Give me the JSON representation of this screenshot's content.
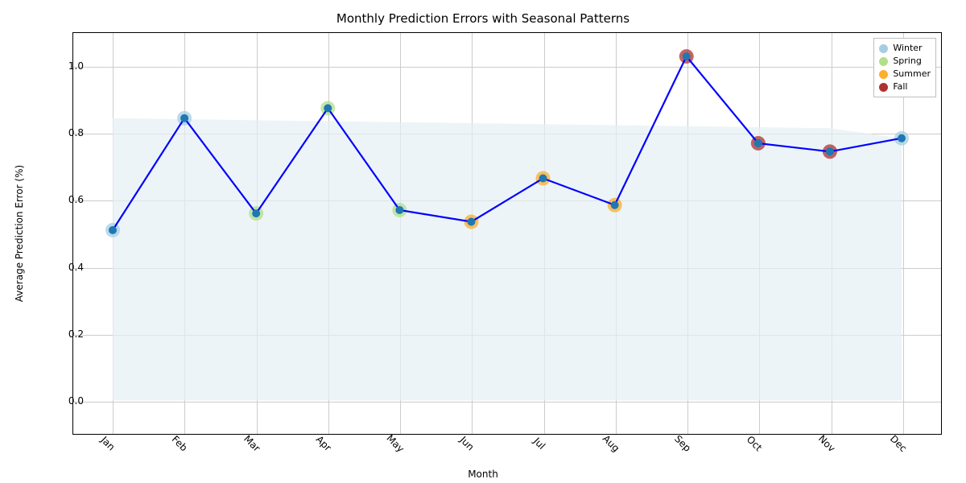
{
  "chart_data": {
    "type": "line",
    "title": "Monthly Prediction Errors with Seasonal Patterns",
    "xlabel": "Month",
    "ylabel": "Average Prediction Error (%)",
    "categories": [
      "Jan",
      "Feb",
      "Mar",
      "Apr",
      "May",
      "Jun",
      "Jul",
      "Aug",
      "Sep",
      "Oct",
      "Nov",
      "Dec"
    ],
    "values": [
      0.51,
      0.845,
      0.56,
      0.875,
      0.57,
      0.535,
      0.665,
      0.585,
      1.03,
      0.77,
      0.745,
      0.785
    ],
    "season_per_point": [
      "Winter",
      "Winter",
      "Spring",
      "Spring",
      "Spring",
      "Summer",
      "Summer",
      "Summer",
      "Fall",
      "Fall",
      "Fall",
      "Winter"
    ],
    "seasons": {
      "Winter": "#a6cee3",
      "Spring": "#b2df8a",
      "Summer": "#fdae2b",
      "Fall": "#b03030"
    },
    "yticks": [
      0.0,
      0.2,
      0.4,
      0.6,
      0.8,
      1.0
    ],
    "ylim": [
      -0.1,
      1.1
    ],
    "xlim": [
      -0.55,
      11.55
    ],
    "line_color": "#0000ff",
    "marker_fill": "#1f77b4",
    "fill_band_color": "#e4eff3",
    "fill_band_from": 0.0,
    "fill_band_to_per_point": [
      0.845,
      0.842,
      0.839,
      0.836,
      0.833,
      0.83,
      0.827,
      0.824,
      0.821,
      0.818,
      0.815,
      0.785
    ],
    "legend_entries": [
      "Winter",
      "Spring",
      "Summer",
      "Fall"
    ]
  }
}
